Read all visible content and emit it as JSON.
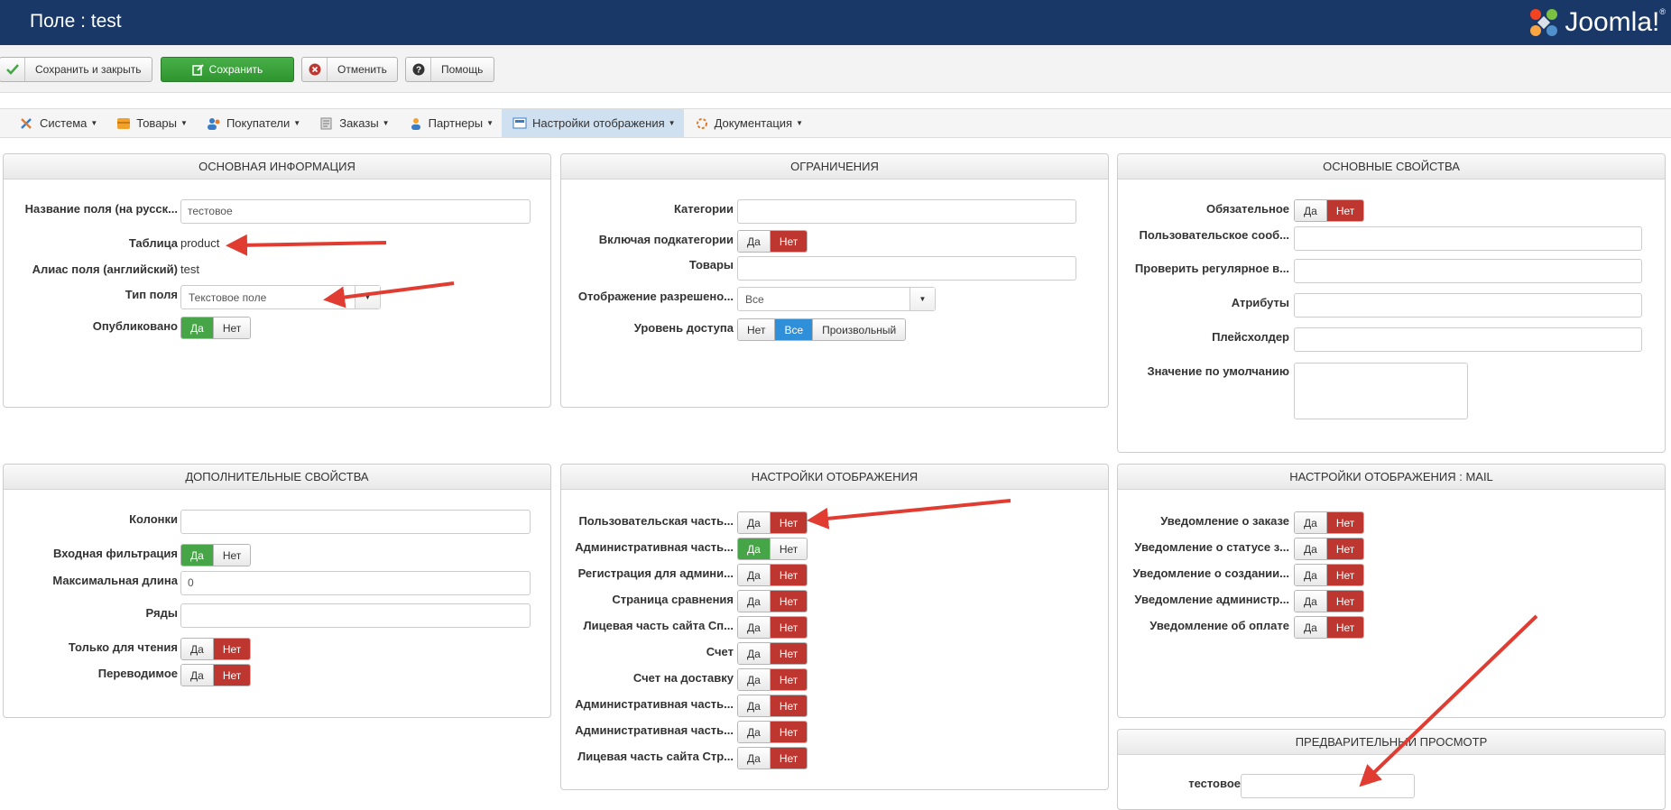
{
  "header": {
    "title": "Поле : test",
    "logo_text": "Joomla!",
    "logo_reg": "®"
  },
  "toolbar": {
    "save_close": "Сохранить и закрыть",
    "save": "Сохранить",
    "cancel": "Отменить",
    "help": "Помощь"
  },
  "menu": [
    {
      "label": "Система",
      "icon": "gear-tools-icon"
    },
    {
      "label": "Товары",
      "icon": "products-icon"
    },
    {
      "label": "Покупатели",
      "icon": "users-icon"
    },
    {
      "label": "Заказы",
      "icon": "orders-icon"
    },
    {
      "label": "Партнеры",
      "icon": "partners-icon"
    },
    {
      "label": "Настройки отображения",
      "icon": "display-icon"
    },
    {
      "label": "Документация",
      "icon": "docs-icon"
    }
  ],
  "panels": {
    "basic": {
      "title": "ОСНОВНАЯ ИНФОРМАЦИЯ",
      "name_label": "Название поля (на русск...",
      "name_value": "тестовое",
      "table_label": "Таблица",
      "table_value": "product",
      "alias_label": "Алиас поля (английский)",
      "alias_value": "test",
      "type_label": "Тип поля",
      "type_value": "Текстовое поле",
      "published_label": "Опубликовано",
      "yes": "Да",
      "no": "Нет"
    },
    "limits": {
      "title": "ОГРАНИЧЕНИЯ",
      "categories_label": "Категории",
      "subcats_label": "Включая подкатегории",
      "products_label": "Товары",
      "display_label": "Отображение разрешено...",
      "display_value": "Все",
      "access_label": "Уровень доступа",
      "access_no": "Нет",
      "access_all": "Все",
      "access_custom": "Произвольный"
    },
    "props": {
      "title": "ОСНОВНЫЕ СВОЙСТВА",
      "required_label": "Обязательное",
      "usermsg_label": "Пользовательское сооб...",
      "regex_label": "Проверить регулярное в...",
      "attrs_label": "Атрибуты",
      "placeholder_label": "Плейсхолдер",
      "default_label": "Значение по умолчанию"
    },
    "extra": {
      "title": "ДОПОЛНИТЕЛЬНЫЕ СВОЙСТВА",
      "cols_label": "Колонки",
      "filter_label": "Входная фильтрация",
      "maxlen_label": "Максимальная длина",
      "maxlen_value": "0",
      "rows_label": "Ряды",
      "readonly_label": "Только для чтения",
      "translatable_label": "Переводимое"
    },
    "display": {
      "title": "НАСТРОЙКИ ОТОБРАЖЕНИЯ",
      "rows": [
        {
          "label": "Пользовательская часть...",
          "state": "no"
        },
        {
          "label": "Административная часть...",
          "state": "yes"
        },
        {
          "label": "Регистрация для админи...",
          "state": "no"
        },
        {
          "label": "Страница сравнения",
          "state": "no"
        },
        {
          "label": "Лицевая часть сайта Сп...",
          "state": "no"
        },
        {
          "label": "Счет",
          "state": "no"
        },
        {
          "label": "Счет на доставку",
          "state": "no"
        },
        {
          "label": "Административная часть...",
          "state": "no"
        },
        {
          "label": "Административная часть...",
          "state": "no"
        },
        {
          "label": "Лицевая часть сайта Стр...",
          "state": "no"
        }
      ]
    },
    "mail": {
      "title": "НАСТРОЙКИ ОТОБРАЖЕНИЯ : MAIL",
      "rows": [
        {
          "label": "Уведомление о заказе"
        },
        {
          "label": "Уведомление о статусе з..."
        },
        {
          "label": "Уведомление о создании..."
        },
        {
          "label": "Уведомление администр..."
        },
        {
          "label": "Уведомление об оплате"
        }
      ]
    },
    "preview": {
      "title": "ПРЕДВАРИТЕЛЬНЫЙ ПРОСМОТР",
      "label": "тестовое"
    }
  },
  "labels": {
    "yes": "Да",
    "no": "Нет"
  },
  "colors": {
    "header": "#1a3867",
    "red": "#bd362f",
    "green": "#46a546",
    "blue": "#2f8fd8",
    "arrow": "#e03c31"
  }
}
